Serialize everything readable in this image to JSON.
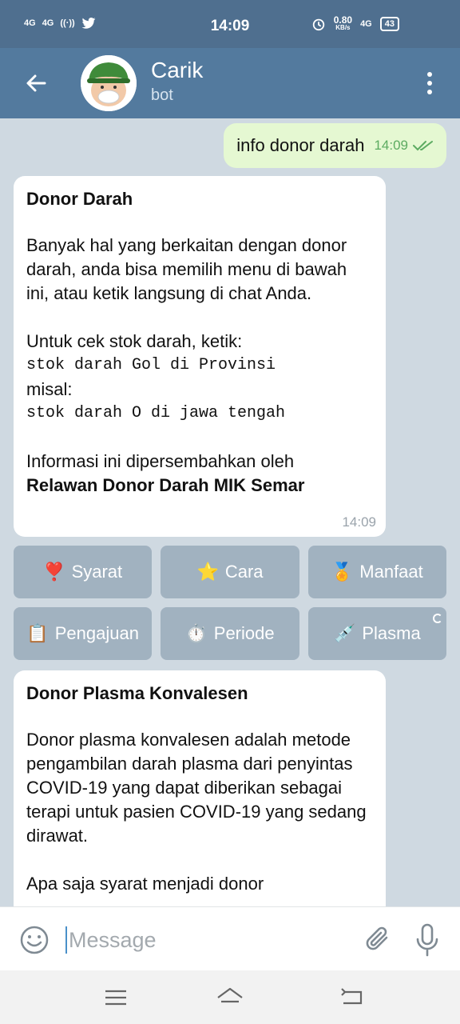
{
  "status_bar": {
    "time": "14:09",
    "left_signal_1": "4G",
    "left_signal_2": "4G",
    "net_speed_value": "0.80",
    "net_speed_unit": "KB/s",
    "network": "4G",
    "battery": "43"
  },
  "header": {
    "title": "Carik",
    "subtitle": "bot"
  },
  "messages": {
    "outgoing": {
      "text": "info donor darah",
      "time": "14:09"
    },
    "incoming_1": {
      "heading": "Donor Darah",
      "paragraph_1": "Banyak hal yang berkaitan dengan donor darah, anda bisa memilih menu di bawah ini, atau ketik langsung di chat Anda.",
      "paragraph_2": "Untuk cek stok darah, ketik:",
      "code_1": "stok darah Gol di Provinsi",
      "example_label": "misal:",
      "code_2": "stok darah O di jawa tengah",
      "credit_text": "Informasi ini dipersembahkan oleh",
      "credit_bold": "Relawan Donor Darah MIK Semar",
      "time": "14:09"
    },
    "incoming_2": {
      "heading": "Donor Plasma Konvalesen",
      "paragraph_1": "Donor plasma konvalesen adalah metode pengambilan darah plasma dari penyintas COVID-19 yang dapat diberikan sebagai terapi untuk pasien COVID-19 yang sedang dirawat.",
      "paragraph_2": "Apa saja syarat menjadi donor"
    }
  },
  "keyboard": {
    "syarat": {
      "emoji": "❣️",
      "label": "Syarat"
    },
    "cara": {
      "emoji": "⭐",
      "label": "Cara"
    },
    "manfaat": {
      "emoji": "🏅",
      "label": "Manfaat"
    },
    "pengajuan": {
      "emoji": "📋",
      "label": "Pengajuan"
    },
    "periode": {
      "emoji": "⏱️",
      "label": "Periode"
    },
    "plasma": {
      "emoji": "💉",
      "label": "Plasma"
    }
  },
  "input": {
    "placeholder": "Message"
  },
  "colors": {
    "header_bg": "#537a9e",
    "status_bg": "#4f6f8f",
    "chat_bg": "#cfd9e1",
    "outgoing_bubble": "#e5f8d2",
    "check_color": "#5cab61"
  },
  "icons": [
    "back-arrow-icon",
    "bot-avatar",
    "more-vert-icon",
    "double-check-icon",
    "emoji-icon",
    "attach-icon",
    "mic-icon",
    "nav-menu-icon",
    "nav-home-icon",
    "nav-back-icon"
  ]
}
